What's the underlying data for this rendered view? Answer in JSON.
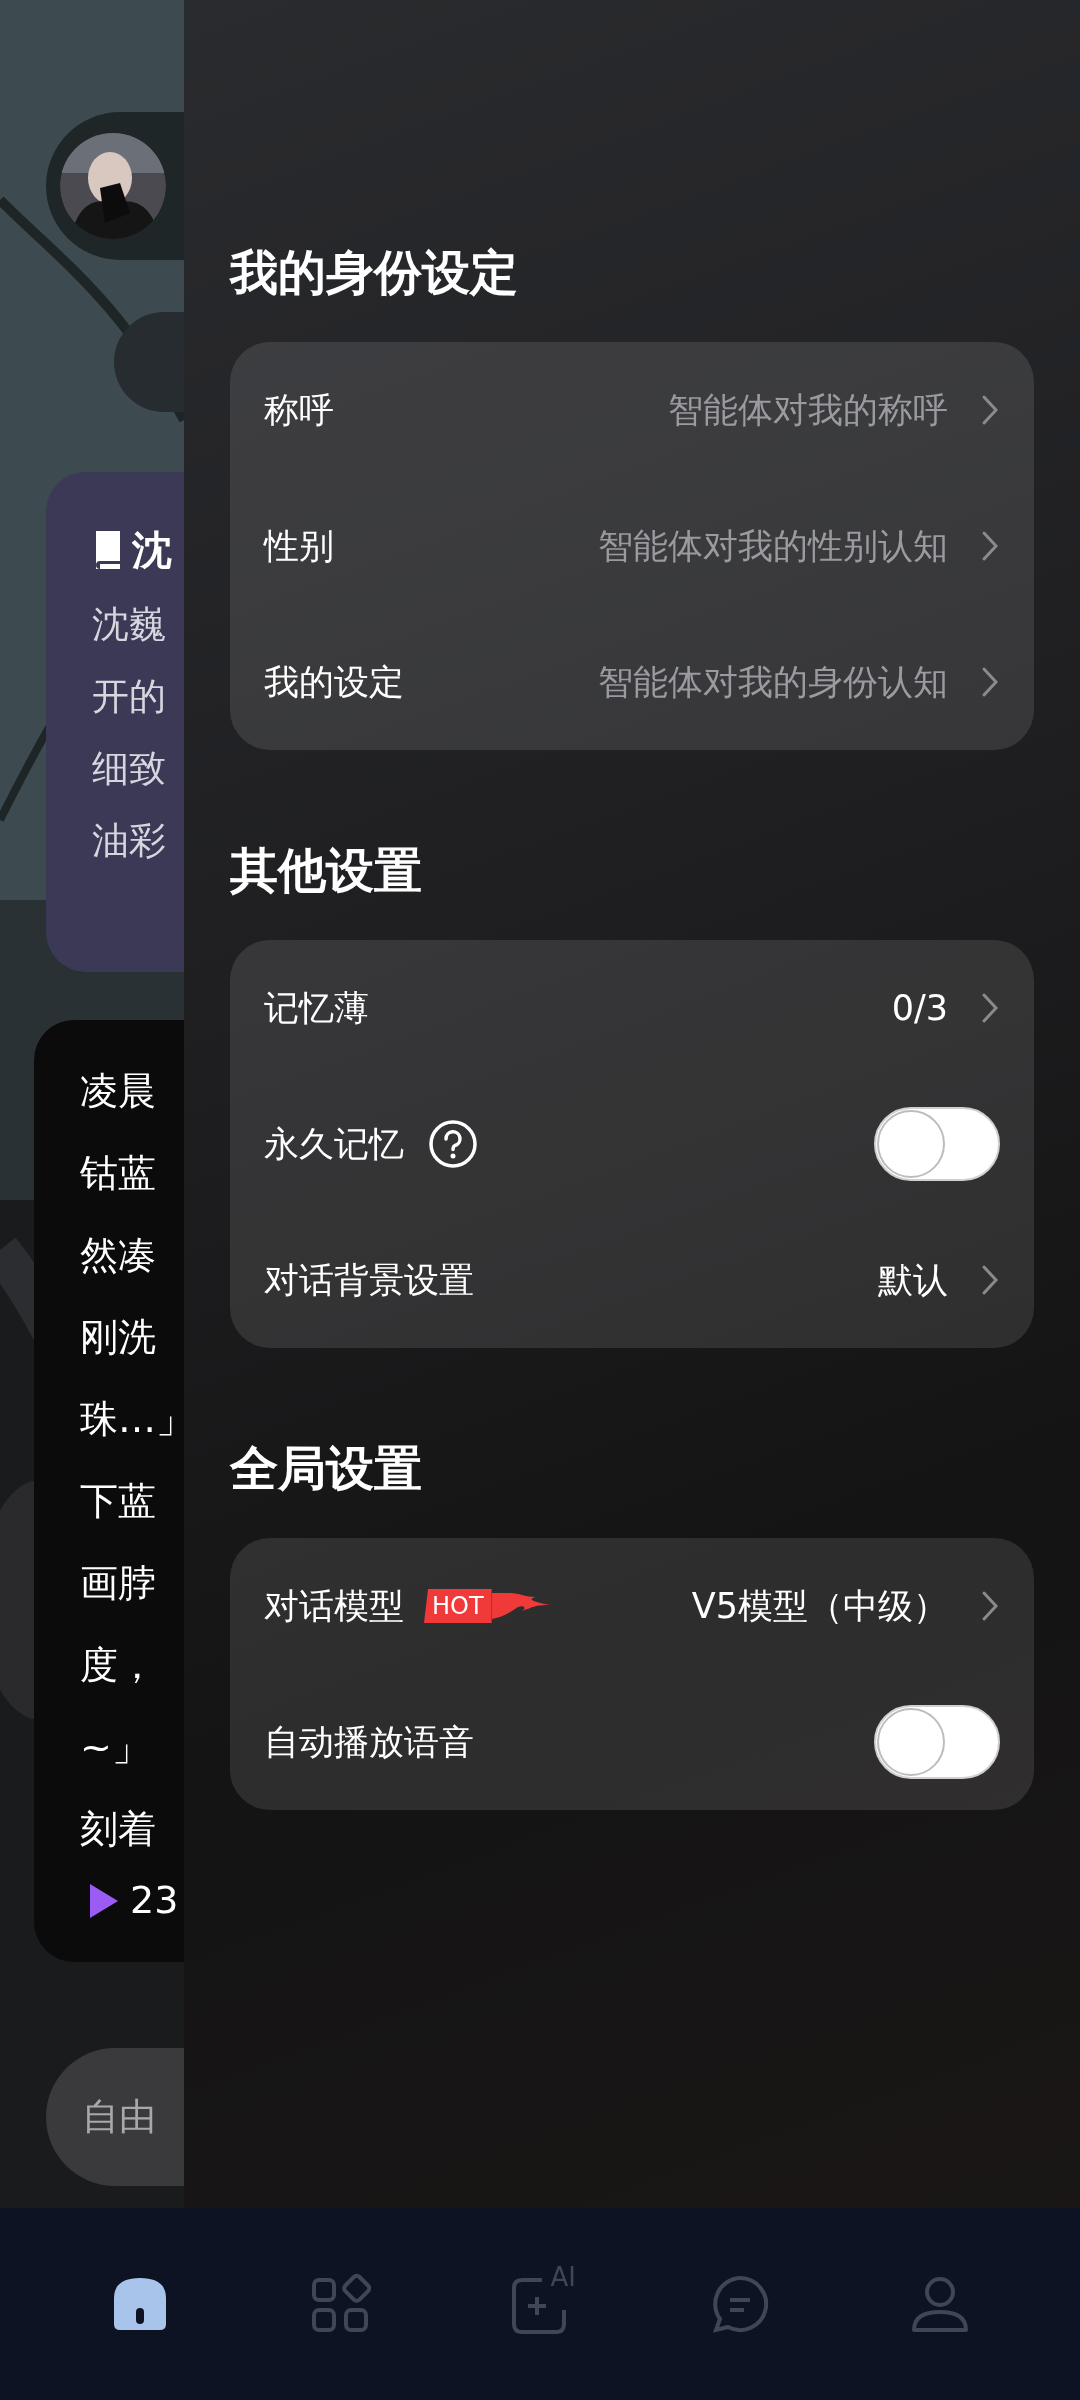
{
  "intro_card": {
    "title": "沈",
    "lines": [
      "沈巍",
      "开的",
      "细致",
      "油彩"
    ]
  },
  "message": {
    "lines": [
      "凌晨",
      "钴蓝",
      "然凑",
      "刚洗",
      "珠…」",
      "下蓝",
      "画脖",
      "度，",
      "~」",
      "刻着"
    ],
    "audio_duration": "23"
  },
  "input": {
    "placeholder": "自由"
  },
  "drawer": {
    "sections": [
      {
        "title": "我的身份设定",
        "rows": [
          {
            "kind": "link",
            "label": "称呼",
            "placeholder": "智能体对我的称呼"
          },
          {
            "kind": "link",
            "label": "性别",
            "placeholder": "智能体对我的性别认知"
          },
          {
            "kind": "link",
            "label": "我的设定",
            "placeholder": "智能体对我的身份认知"
          }
        ]
      },
      {
        "title": "其他设置",
        "rows": [
          {
            "kind": "link",
            "label": "记忆薄",
            "value": "0/3"
          },
          {
            "kind": "toggle",
            "label": "永久记忆",
            "help": true,
            "on": false
          },
          {
            "kind": "link",
            "label": "对话背景设置",
            "value": "默认"
          }
        ]
      },
      {
        "title": "全局设置",
        "rows": [
          {
            "kind": "link",
            "label": "对话模型",
            "badge": "HOT",
            "value": "V5模型（中级）"
          },
          {
            "kind": "toggle",
            "label": "自动播放语音",
            "on": false
          }
        ]
      }
    ]
  },
  "nav": {
    "items": [
      {
        "kind": "home",
        "selected": true
      },
      {
        "kind": "apps",
        "selected": false
      },
      {
        "kind": "create",
        "label": "AI",
        "selected": false
      },
      {
        "kind": "messages",
        "selected": false
      },
      {
        "kind": "profile",
        "selected": false
      }
    ]
  }
}
